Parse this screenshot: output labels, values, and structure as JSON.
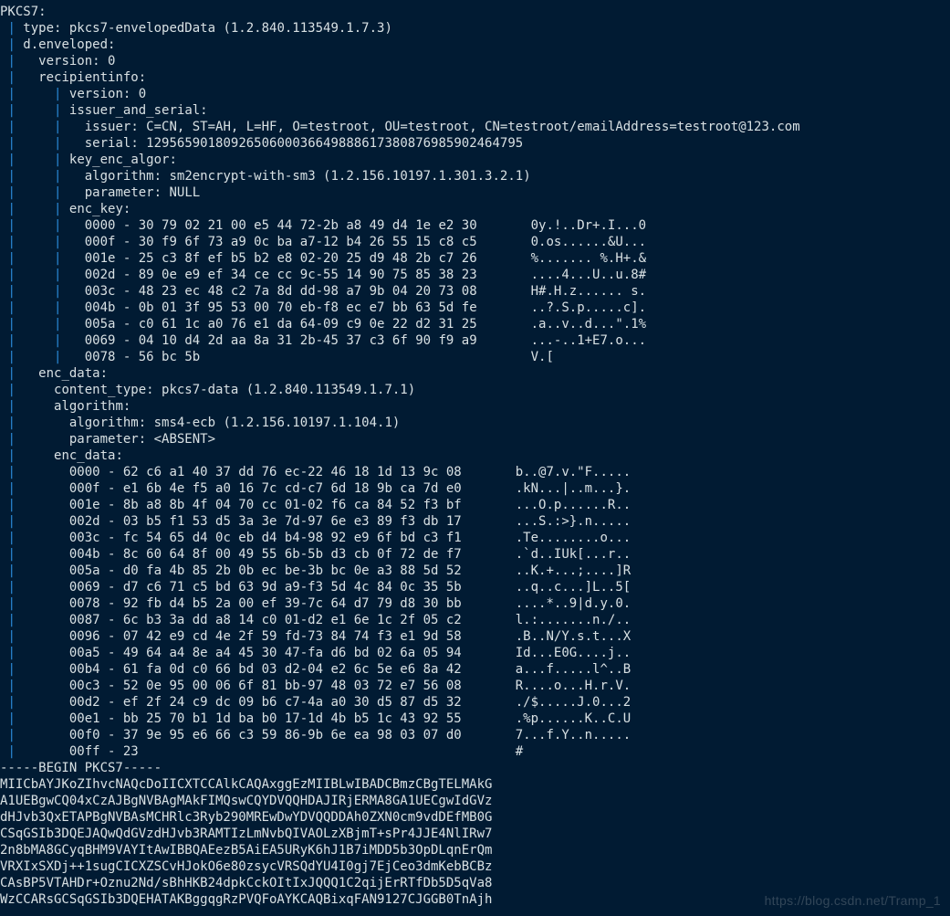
{
  "pkcs7": {
    "header": "PKCS7:",
    "type_label": "type: pkcs7-envelopedData (1.2.840.113549.1.7.3)",
    "envelope_label": "d.enveloped:",
    "version_label": "version: 0",
    "recipientinfo_label": "recipientinfo:",
    "recipient": {
      "version_label": "version: 0",
      "issuer_serial_label": "issuer_and_serial:",
      "issuer": "issuer: C=CN, ST=AH, L=HF, O=testroot, OU=testroot, CN=testroot/emailAddress=testroot@123.com",
      "serial": "serial: 1295659018092650600036649888617380876985902464795",
      "key_enc_algor_label": "key_enc_algor:",
      "algorithm": "algorithm: sm2encrypt-with-sm3 (1.2.156.10197.1.301.3.2.1)",
      "parameter": "parameter: NULL",
      "enc_key_label": "enc_key:"
    },
    "enc_key_dump": [
      {
        "hex": "0000 - 30 79 02 21 00 e5 44 72-2b a8 49 d4 1e e2 30",
        "ascii": "0y.!..Dr+.I...0"
      },
      {
        "hex": "000f - 30 f9 6f 73 a9 0c ba a7-12 b4 26 55 15 c8 c5",
        "ascii": "0.os......&U..."
      },
      {
        "hex": "001e - 25 c3 8f ef b5 b2 e8 02-20 25 d9 48 2b c7 26",
        "ascii": "%....... %.H+.&"
      },
      {
        "hex": "002d - 89 0e e9 ef 34 ce cc 9c-55 14 90 75 85 38 23",
        "ascii": "....4...U..u.8#"
      },
      {
        "hex": "003c - 48 23 ec 48 c2 7a 8d dd-98 a7 9b 04 20 73 08",
        "ascii": "H#.H.z...... s."
      },
      {
        "hex": "004b - 0b 01 3f 95 53 00 70 eb-f8 ec e7 bb 63 5d fe",
        "ascii": "..?.S.p.....c]."
      },
      {
        "hex": "005a - c0 61 1c a0 76 e1 da 64-09 c9 0e 22 d2 31 25",
        "ascii": ".a..v..d...\".1%"
      },
      {
        "hex": "0069 - 04 10 d4 2d aa 8a 31 2b-45 37 c3 6f 90 f9 a9",
        "ascii": "...-..1+E7.o..."
      },
      {
        "hex": "0078 - 56 bc 5b",
        "ascii": "V.["
      }
    ],
    "enc_data_label": "enc_data:",
    "enc_data": {
      "content_type": "content_type: pkcs7-data (1.2.840.113549.1.7.1)",
      "algorithm_label": "algorithm:",
      "algorithm": "algorithm: sms4-ecb (1.2.156.10197.1.104.1)",
      "parameter": "parameter: <ABSENT>",
      "enc_data_label": "enc_data:"
    },
    "enc_data_dump": [
      {
        "hex": "0000 - 62 c6 a1 40 37 dd 76 ec-22 46 18 1d 13 9c 08",
        "ascii": "b..@7.v.\"F....."
      },
      {
        "hex": "000f - e1 6b 4e f5 a0 16 7c cd-c7 6d 18 9b ca 7d e0",
        "ascii": ".kN...|..m...}."
      },
      {
        "hex": "001e - 8b a8 8b 4f 04 70 cc 01-02 f6 ca 84 52 f3 bf",
        "ascii": "...O.p......R.."
      },
      {
        "hex": "002d - 03 b5 f1 53 d5 3a 3e 7d-97 6e e3 89 f3 db 17",
        "ascii": "...S.:>}.n....."
      },
      {
        "hex": "003c - fc 54 65 d4 0c eb d4 b4-98 92 e9 6f bd c3 f1",
        "ascii": ".Te........o..."
      },
      {
        "hex": "004b - 8c 60 64 8f 00 49 55 6b-5b d3 cb 0f 72 de f7",
        "ascii": ".`d..IUk[...r.."
      },
      {
        "hex": "005a - d0 fa 4b 85 2b 0b ec be-3b bc 0e a3 88 5d 52",
        "ascii": "..K.+...;....]R"
      },
      {
        "hex": "0069 - d7 c6 71 c5 bd 63 9d a9-f3 5d 4c 84 0c 35 5b",
        "ascii": "..q..c...]L..5["
      },
      {
        "hex": "0078 - 92 fb d4 b5 2a 00 ef 39-7c 64 d7 79 d8 30 bb",
        "ascii": "....*..9|d.y.0."
      },
      {
        "hex": "0087 - 6c b3 3a dd a8 14 c0 01-d2 e1 6e 1c 2f 05 c2",
        "ascii": "l.:.......n./.."
      },
      {
        "hex": "0096 - 07 42 e9 cd 4e 2f 59 fd-73 84 74 f3 e1 9d 58",
        "ascii": ".B..N/Y.s.t...X"
      },
      {
        "hex": "00a5 - 49 64 a4 8e a4 45 30 47-fa d6 bd 02 6a 05 94",
        "ascii": "Id...E0G....j.."
      },
      {
        "hex": "00b4 - 61 fa 0d c0 66 bd 03 d2-04 e2 6c 5e e6 8a 42",
        "ascii": "a...f.....l^..B"
      },
      {
        "hex": "00c3 - 52 0e 95 00 06 6f 81 bb-97 48 03 72 e7 56 08",
        "ascii": "R....o...H.r.V."
      },
      {
        "hex": "00d2 - ef 2f 24 c9 dc 09 b6 c7-4a a0 30 d5 87 d5 32",
        "ascii": "./$.....J.0...2"
      },
      {
        "hex": "00e1 - bb 25 70 b1 1d ba b0 17-1d 4b b5 1c 43 92 55",
        "ascii": ".%p......K..C.U"
      },
      {
        "hex": "00f0 - 37 9e 95 e6 66 c3 59 86-9b 6e ea 98 03 07 d0",
        "ascii": "7...f.Y..n....."
      },
      {
        "hex": "00ff - 23",
        "ascii": "#"
      }
    ],
    "pem_header": "-----BEGIN PKCS7-----",
    "pem_lines": [
      "MIICbAYJKoZIhvcNAQcDoIICXTCCAlkCAQAxggEzMIIBLwIBADCBmzCBgTELMAkG",
      "A1UEBgwCQ04xCzAJBgNVBAgMAkFIMQswCQYDVQQHDAJIRjERMA8GA1UECgwIdGVz",
      "dHJvb3QxETAPBgNVBAsMCHRlc3Ryb290MREwDwYDVQQDDAh0ZXN0cm9vdDEfMB0G",
      "CSqGSIb3DQEJAQwQdGVzdHJvb3RAMTIzLmNvbQIVAOLzXBjmT+sPr4JJE4NlIRw7",
      "2n8bMA8GCyqBHM9VAYItAwIBBQAEezB5AiEA5URyK6hJ1B7iMDD5b3OpDLqnErQm",
      "VRXIxSXDj++1sugCICXZSCvHJokO6e80zsycVRSQdYU4I0gj7EjCeo3dmKebBCBz",
      "CAsBP5VTAHDr+Oznu2Nd/sBhHKB24dpkCckOItIxJQQQ1C2qijErRTfDb5D5qVa8",
      "WzCCARsGCSqGSIb3DQEHATAKBggqgRzPVQFoAYKCAQBixqFAN9127CJGGB0TnAjh"
    ]
  },
  "watermark": "https://blog.csdn.net/Tramp_1"
}
